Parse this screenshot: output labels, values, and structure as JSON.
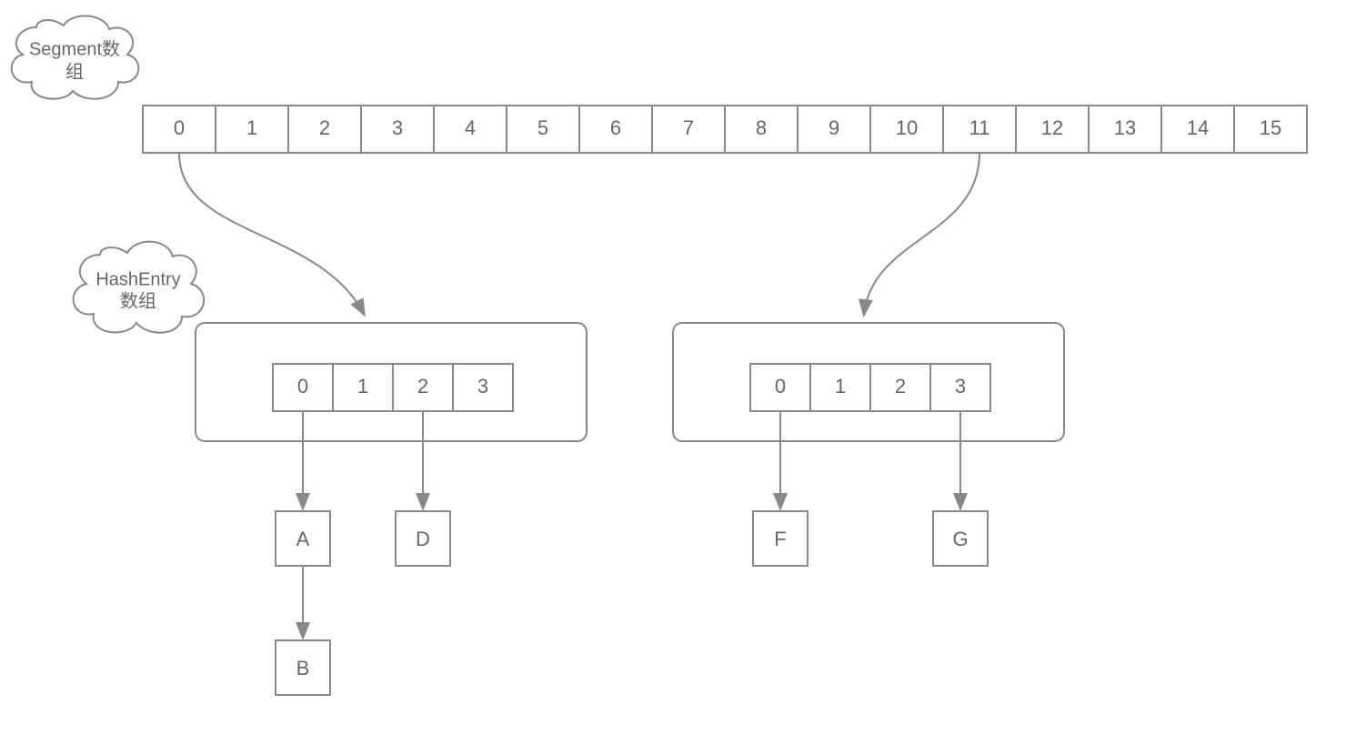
{
  "clouds": {
    "segment": {
      "line1": "Segment数",
      "line2": "组"
    },
    "hashentry": {
      "line1": "HashEntry",
      "line2": "数组"
    }
  },
  "segmentArray": [
    "0",
    "1",
    "2",
    "3",
    "4",
    "5",
    "6",
    "7",
    "8",
    "9",
    "10",
    "11",
    "12",
    "13",
    "14",
    "15"
  ],
  "hashEntryArrays": {
    "left": [
      "0",
      "1",
      "2",
      "3"
    ],
    "right": [
      "0",
      "1",
      "2",
      "3"
    ]
  },
  "nodes": {
    "A": "A",
    "B": "B",
    "D": "D",
    "F": "F",
    "G": "G"
  }
}
